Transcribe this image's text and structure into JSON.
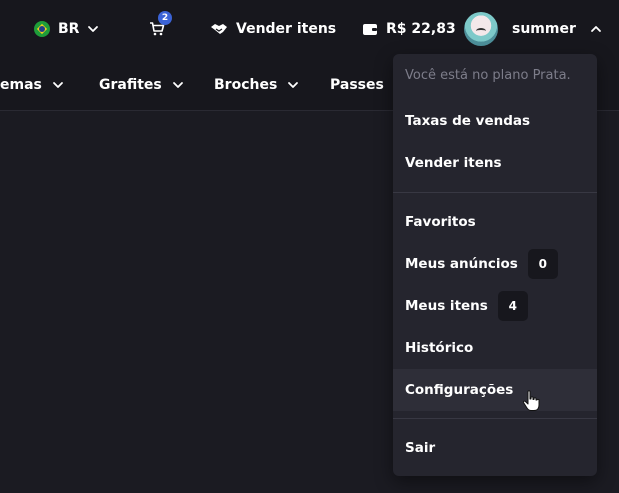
{
  "header": {
    "region": "BR",
    "cart_count": "2",
    "sell_label": "Vender itens",
    "balance": "R$ 22,83",
    "username": "summer"
  },
  "nav": {
    "items": [
      "emas",
      "Grafites",
      "Broches",
      "Passes"
    ]
  },
  "user_menu": {
    "plan_notice": "Você está no plano Prata.",
    "sales_fees": "Taxas de vendas",
    "sell_items": "Vender itens",
    "favorites": "Favoritos",
    "my_listings": "Meus anúncios",
    "my_listings_count": "0",
    "my_items": "Meus itens",
    "my_items_count": "4",
    "history": "Histórico",
    "settings": "Configurações",
    "logout": "Sair"
  },
  "colors": {
    "background": "#1b1b22",
    "bar": "#17171d",
    "menu": "#25252e",
    "cart_badge": "#3b63d6"
  }
}
